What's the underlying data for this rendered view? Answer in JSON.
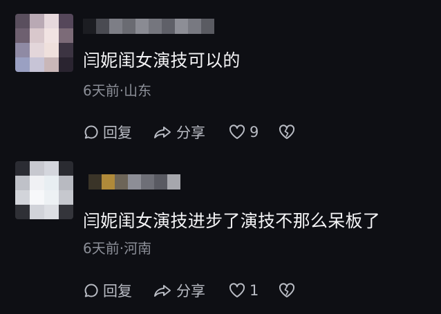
{
  "comments": [
    {
      "text": "闫妮闺女演技可以的",
      "meta": "6天前·山东",
      "reply_label": "回复",
      "share_label": "分享",
      "like_count": "9"
    },
    {
      "text": "闫妮闺女演技进步了演技不那么呆板了",
      "meta": "6天前·河南",
      "reply_label": "回复",
      "share_label": "分享",
      "like_count": "1"
    }
  ],
  "icons": {
    "reply": "chat-bubble-icon",
    "share": "share-arrow-icon",
    "like": "heart-icon",
    "dislike": "broken-heart-icon"
  },
  "colors": {
    "background": "#0e0f14",
    "text": "#f4f4f6",
    "meta": "#8c8f98",
    "action": "#b9bcc4"
  }
}
